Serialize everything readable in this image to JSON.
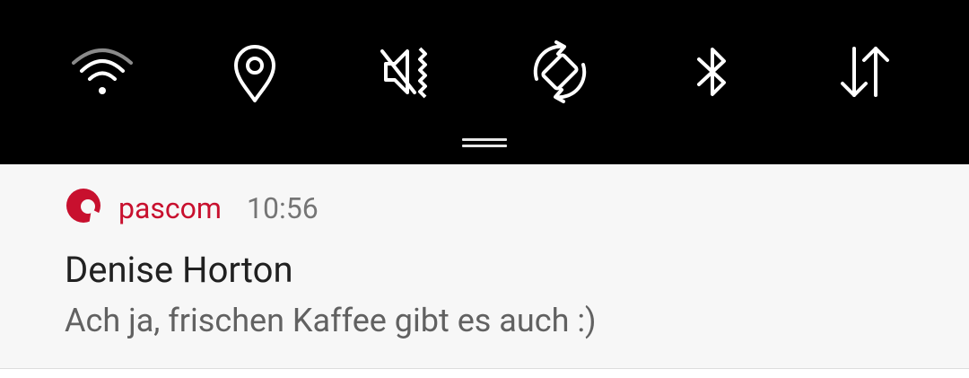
{
  "quick_settings": {
    "tiles": [
      {
        "icon": "wifi-icon",
        "state": "on"
      },
      {
        "icon": "location-icon",
        "state": "on"
      },
      {
        "icon": "mute-vibrate-icon",
        "state": "on"
      },
      {
        "icon": "auto-rotate-icon",
        "state": "on"
      },
      {
        "icon": "bluetooth-icon",
        "state": "on"
      },
      {
        "icon": "mobile-data-icon",
        "state": "on"
      }
    ],
    "background_color": "#000000",
    "icon_color": "#ffffff"
  },
  "notification": {
    "app_icon": "pascom-logo-icon",
    "app_name": "pascom",
    "app_color": "#c8102e",
    "time": "10:56",
    "title": "Denise Horton",
    "text": "Ach ja, frischen Kaffee gibt es auch :)"
  }
}
